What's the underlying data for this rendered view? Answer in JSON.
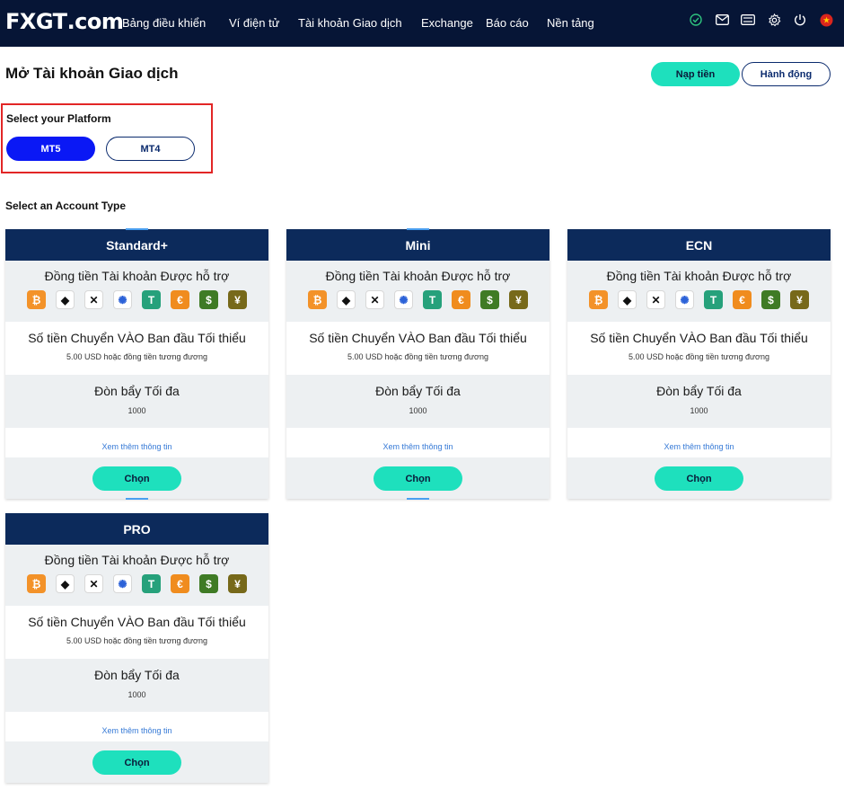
{
  "brand": {
    "logo_main": "FX",
    "logo_gt": "GT",
    "logo_dot": ".com"
  },
  "nav": {
    "items": [
      "Bảng điều khiển",
      "Ví điện tử",
      "Tài khoản Giao dịch",
      "Exchange",
      "Báo cáo",
      "Nền tảng"
    ]
  },
  "top_icons": [
    "check-circle-icon",
    "mail-icon",
    "ticket-icon",
    "gear-icon",
    "power-icon",
    "vietnam-flag-icon"
  ],
  "page": {
    "title": "Mở Tài khoản Giao dịch",
    "deposit_label": "Nạp tiền",
    "action_label": "Hành động"
  },
  "platform": {
    "label": "Select your Platform",
    "options": [
      "MT5",
      "MT4"
    ],
    "selected": "MT5"
  },
  "account_type_label": "Select an Account Type",
  "coins": [
    {
      "icon": "bitcoin-icon",
      "glyph": "₿",
      "color": "#f39229"
    },
    {
      "icon": "ethereum-icon",
      "glyph": "◆",
      "color": "#ffffff"
    },
    {
      "icon": "xrp-icon",
      "glyph": "✕",
      "color": "#ffffff"
    },
    {
      "icon": "cardano-icon",
      "glyph": "✺",
      "color": "#ffffff"
    },
    {
      "icon": "tether-icon",
      "glyph": "T",
      "color": "#26a17b"
    },
    {
      "icon": "euro-icon",
      "glyph": "€",
      "color": "#f08c1e"
    },
    {
      "icon": "dollar-icon",
      "glyph": "$",
      "color": "#3f7b25"
    },
    {
      "icon": "yen-icon",
      "glyph": "¥",
      "color": "#77691a"
    }
  ],
  "cards": [
    {
      "name": "Standard+",
      "currency_title": "Đồng tiền Tài khoản Được hỗ trợ",
      "deposit_title": "Số tiền Chuyển VÀO Ban đầu Tối thiểu",
      "deposit_value": "5.00 USD hoặc đồng tiền tương đương",
      "leverage_title": "Đòn bẩy Tối đa",
      "leverage_value": "1000",
      "more_link": "Xem thêm thông tin",
      "choose_label": "Chọn"
    },
    {
      "name": "Mini",
      "currency_title": "Đồng tiền Tài khoản Được hỗ trợ",
      "deposit_title": "Số tiền Chuyển VÀO Ban đầu Tối thiểu",
      "deposit_value": "5.00 USD hoặc đồng tiền tương đương",
      "leverage_title": "Đòn bẩy Tối đa",
      "leverage_value": "1000",
      "more_link": "Xem thêm thông tin",
      "choose_label": "Chọn"
    },
    {
      "name": "ECN",
      "currency_title": "Đồng tiền Tài khoản Được hỗ trợ",
      "deposit_title": "Số tiền Chuyển VÀO Ban đầu Tối thiểu",
      "deposit_value": "5.00 USD hoặc đồng tiền tương đương",
      "leverage_title": "Đòn bẩy Tối đa",
      "leverage_value": "1000",
      "more_link": "Xem thêm thông tin",
      "choose_label": "Chọn"
    },
    {
      "name": "PRO",
      "currency_title": "Đồng tiền Tài khoản Được hỗ trợ",
      "deposit_title": "Số tiền Chuyển VÀO Ban đầu Tối thiểu",
      "deposit_value": "5.00 USD hoặc đồng tiền tương đương",
      "leverage_title": "Đòn bẩy Tối đa",
      "leverage_value": "1000",
      "more_link": "Xem thêm thông tin",
      "choose_label": "Chọn"
    }
  ],
  "colors": {
    "nav_bg": "#061536",
    "card_header": "#0c2a5b",
    "accent": "#1ee0bd",
    "platform_active": "#0a18f5",
    "highlight_border": "#e22626"
  }
}
